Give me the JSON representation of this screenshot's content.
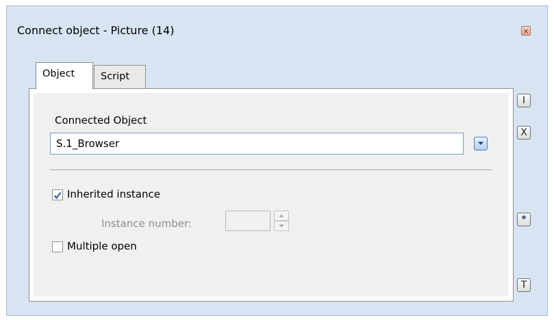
{
  "window": {
    "title": "Connect object - Picture (14)"
  },
  "tabs": [
    {
      "label": "Object",
      "active": true
    },
    {
      "label": "Script",
      "active": false
    }
  ],
  "object_tab": {
    "connected_object_label": "Connected Object",
    "connected_object_value": "S.1_Browser",
    "inherited_instance": {
      "label": "Inherited instance",
      "checked": true
    },
    "instance_number": {
      "label": "Instance number:",
      "value": "",
      "enabled": false
    },
    "multiple_open": {
      "label": "Multiple open",
      "checked": false
    }
  },
  "side_buttons": {
    "i": "I",
    "x": "X",
    "star": "*",
    "t": "T"
  },
  "colors": {
    "window_bg": "#d7e4f2",
    "check_color": "#3a5ea8"
  }
}
